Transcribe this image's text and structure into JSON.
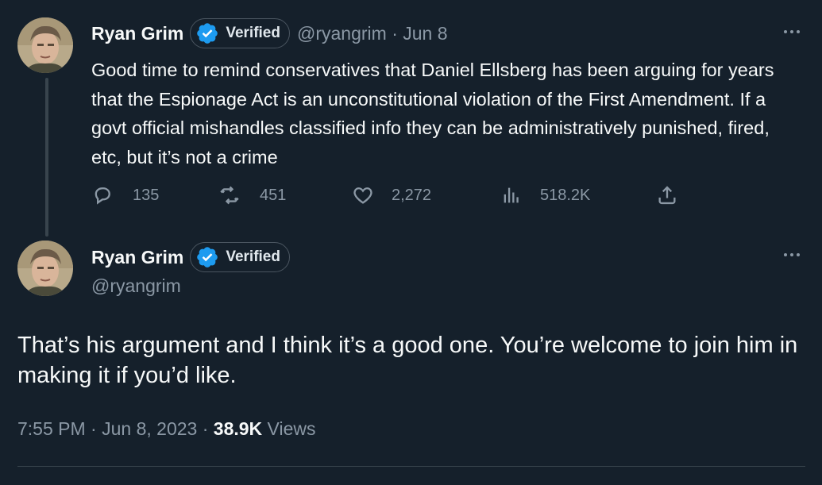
{
  "tweet1": {
    "name": "Ryan Grim",
    "verified_label": "Verified",
    "handle": "@ryangrim",
    "separator": "·",
    "date": "Jun 8",
    "text": "Good time to remind conservatives that Daniel Ellsberg has been arguing for years that the Espionage Act is an unconstitutional violation of the First Amendment. If a govt official mishandles classified info they can be administratively punished, fired, etc, but it’s not a crime",
    "replies": "135",
    "reposts": "451",
    "likes": "2,272",
    "views": "518.2K"
  },
  "tweet2": {
    "name": "Ryan Grim",
    "verified_label": "Verified",
    "handle": "@ryangrim",
    "text": "That’s his argument and I think it’s a good one. You’re welcome to join him in making it if you’d like.",
    "time": "7:55 PM",
    "separator": "·",
    "date": "Jun 8, 2023",
    "separator2": "·",
    "views_count": "38.9K",
    "views_label": "Views"
  },
  "colors": {
    "background": "#15202b",
    "text": "#f7f9f9",
    "muted": "#8b98a5",
    "verified_badge": "#1d9bf0"
  },
  "icons": [
    "reply-icon",
    "repost-icon",
    "like-icon",
    "views-icon",
    "share-icon",
    "verified-badge-icon",
    "more-icon"
  ]
}
